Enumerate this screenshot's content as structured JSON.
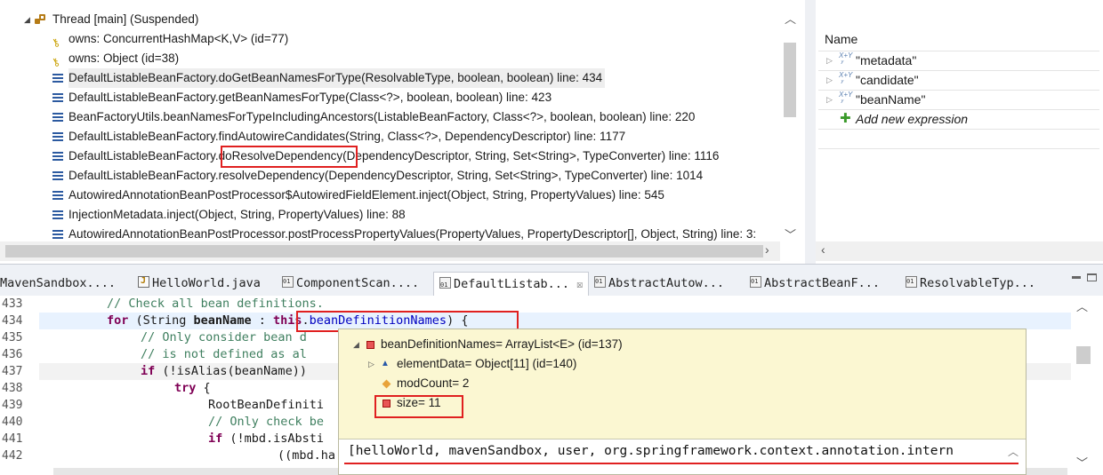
{
  "debug_view": {
    "thread": "Thread [main] (Suspended)",
    "frames": [
      {
        "icon": "key-icon",
        "text": "owns: ConcurrentHashMap<K,V>  (id=77)"
      },
      {
        "icon": "key-icon",
        "text": "owns: Object  (id=38)"
      },
      {
        "icon": "stack-frame-icon",
        "text": "DefaultListableBeanFactory.doGetBeanNamesForType(ResolvableType, boolean, boolean) line: 434"
      },
      {
        "icon": "stack-frame-icon",
        "text": "DefaultListableBeanFactory.getBeanNamesForType(Class<?>, boolean, boolean) line: 423"
      },
      {
        "icon": "stack-frame-icon",
        "text": "BeanFactoryUtils.beanNamesForTypeIncludingAncestors(ListableBeanFactory, Class<?>, boolean, boolean) line: 220"
      },
      {
        "icon": "stack-frame-icon",
        "text": "DefaultListableBeanFactory.findAutowireCandidates(String, Class<?>, DependencyDescriptor) line: 1177"
      },
      {
        "icon": "stack-frame-icon",
        "text": "DefaultListableBeanFactory.doResolveDependency(DependencyDescriptor, String, Set<String>, TypeConverter) line: 1116"
      },
      {
        "icon": "stack-frame-icon",
        "text": "DefaultListableBeanFactory.resolveDependency(DependencyDescriptor, String, Set<String>, TypeConverter) line: 1014"
      },
      {
        "icon": "stack-frame-icon",
        "text": "AutowiredAnnotationBeanPostProcessor$AutowiredFieldElement.inject(Object, String, PropertyValues) line: 545"
      },
      {
        "icon": "stack-frame-icon",
        "text": "InjectionMetadata.inject(Object, String, PropertyValues) line: 88"
      },
      {
        "icon": "stack-frame-icon",
        "text": "AutowiredAnnotationBeanPostProcessor.postProcessPropertyValues(PropertyValues, PropertyDescriptor[], Object, String) line: 3:"
      }
    ]
  },
  "expressions_view": {
    "header": "Name",
    "items": [
      "\"metadata\"",
      "\"candidate\"",
      "\"beanName\""
    ],
    "add_label": "Add new expression"
  },
  "editor_tabs": [
    {
      "label": "MavenSandbox....",
      "icon": "class-file-icon"
    },
    {
      "label": "HelloWorld.java",
      "icon": "java-file-icon"
    },
    {
      "label": "ComponentScan....",
      "icon": "class-file-icon"
    },
    {
      "label": "DefaultListab...",
      "icon": "class-file-icon",
      "active": true,
      "close": "☒"
    },
    {
      "label": "AbstractAutow...",
      "icon": "class-file-icon"
    },
    {
      "label": "AbstractBeanF...",
      "icon": "class-file-icon"
    },
    {
      "label": "ResolvableTyp...",
      "icon": "class-file-icon"
    }
  ],
  "editor": {
    "line_numbers": [
      "433",
      "434",
      "435",
      "436",
      "437",
      "438",
      "439",
      "440",
      "441",
      "442"
    ],
    "l433": "// Check all bean definitions.",
    "l434_kw": "for",
    "l434_a": " (String ",
    "l434_var": "beanName",
    "l434_b": " : ",
    "l434_this": "this",
    "l434_dot": ".",
    "l434_field": "beanDefinitionNames",
    "l434_c": ") {",
    "l435": "// Only consider bean d",
    "l436": "// is not defined as al",
    "l437_kw": "if",
    "l437_a": " (!isAlias(beanName)) ",
    "l438_kw": "try",
    "l438_a": " {",
    "l439": "RootBeanDefiniti",
    "l440": "// Only check be",
    "l441_kw": "if",
    "l441_a": " (!mbd.isAbsti",
    "l442": "((mbd.ha"
  },
  "inspector": {
    "root": "beanDefinitionNames= ArrayList<E>  (id=137)",
    "children": [
      {
        "text": "elementData= Object[11]  (id=140)"
      },
      {
        "text": "modCount= 2"
      },
      {
        "text": "size= 11"
      }
    ],
    "detail": "[helloWorld, mavenSandbox, user, org.springframework.context.annotation.intern"
  },
  "colors": {
    "highlight_box": "#e02020",
    "keyword": "#7f0055",
    "comment": "#3f7f5f",
    "field": "#0000c0",
    "inspector_bg": "#fbf7d2"
  }
}
